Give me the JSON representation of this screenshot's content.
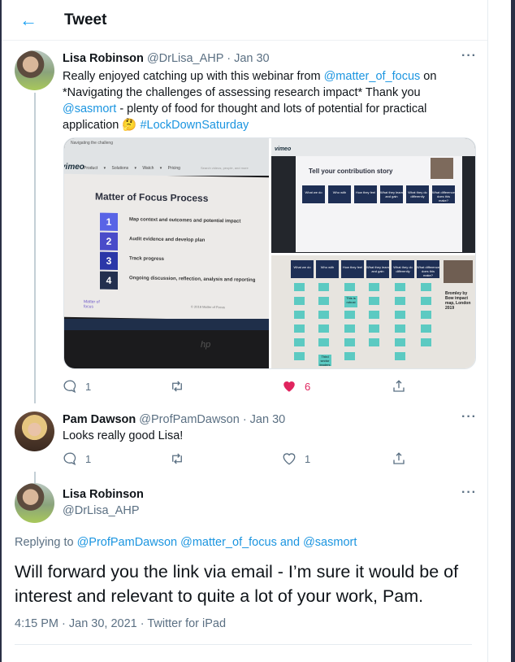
{
  "header": {
    "title": "Tweet",
    "back_icon": "arrow-left-icon"
  },
  "colors": {
    "accent": "#1da1f2",
    "like": "#e0245e",
    "muted": "#5b7083"
  },
  "tweet1": {
    "name": "Lisa Robinson",
    "handle": "@DrLisa_AHP",
    "date": "· Jan 30",
    "text": {
      "p1": "Really enjoyed catching up with this webinar from ",
      "m1": "@matter_of_focus",
      "p2": " on *Navigating the challenges of assessing research impact* Thank you ",
      "m2": "@sasmort",
      "p3": " - plenty of food for thought and lots of potential for practical application ",
      "emoji": "🤔",
      "p4": " ",
      "hashtag": "#LockDownSaturday"
    },
    "media": {
      "photo1": {
        "tab": "Navigating the challeng",
        "nav": [
          "Product ▾",
          "Solutions ▾",
          "Watch ▾",
          "Pricing"
        ],
        "search": "Search videos, people, and more",
        "brand": "vimeo",
        "title": "Matter of Focus Process",
        "steps": [
          {
            "n": "1",
            "t": "Map context and outcomes and potential impact"
          },
          {
            "n": "2",
            "t": "Audit evidence and develop plan"
          },
          {
            "n": "3",
            "t": "Track progress"
          },
          {
            "n": "4",
            "t": "Ongoing discussion, reflection, analysis and reporting"
          }
        ],
        "logo": "Matter of focus",
        "copyright": "© 2019 Matter of Focus",
        "laptop": "hp"
      },
      "photo2": {
        "brand": "vimeo",
        "title": "Tell your contribution story",
        "boxes": [
          "What we do",
          "Who with",
          "How they feel",
          "What they learn and gain",
          "What they do differently",
          "What difference does this make?"
        ]
      },
      "photo3": {
        "boxes": [
          "What we do",
          "Who with",
          "How they feel",
          "What they learn and gain",
          "What they do differently",
          "What difference does this make?"
        ],
        "notes": [
          "This is robust",
          "Third sector leaders"
        ],
        "caption": "Bromley by Bow impact map, London 2019"
      }
    },
    "actions": {
      "reply": "1",
      "retweet": "",
      "like": "6",
      "liked": true
    }
  },
  "tweet2": {
    "name": "Pam Dawson",
    "handle": "@ProfPamDawson",
    "date": "· Jan 30",
    "text": "Looks really good Lisa!",
    "actions": {
      "reply": "1",
      "retweet": "",
      "like": "1",
      "liked": false
    }
  },
  "tweet3": {
    "name": "Lisa Robinson",
    "handle": "@DrLisa_AHP",
    "replying_label": "Replying to ",
    "reply_to": [
      "@ProfPamDawson",
      "@matter_of_focus"
    ],
    "and": " and ",
    "reply_to_last": "@sasmort",
    "text": "Will forward you the link via email - I’m sure it would be of interest and relevant to quite a lot of your work, Pam.",
    "meta": "4:15 PM · Jan 30, 2021 · Twitter for iPad"
  }
}
